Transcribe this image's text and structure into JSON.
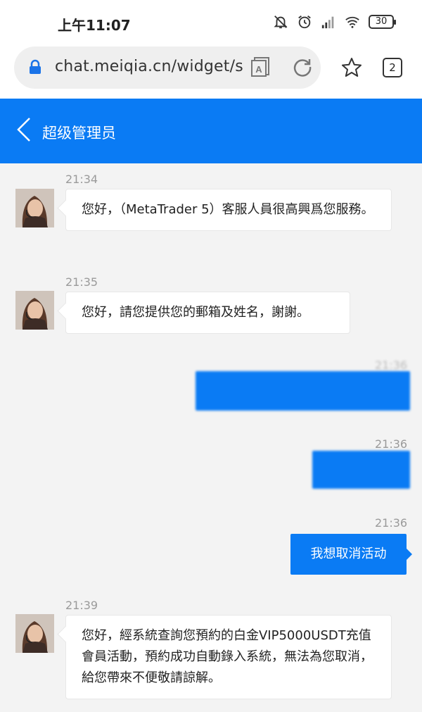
{
  "status_bar": {
    "time": "上午11:07",
    "battery": "30",
    "icons": [
      "mute-icon",
      "alarm-icon",
      "signal-icon",
      "wifi-icon",
      "battery-icon"
    ]
  },
  "browser": {
    "url": "chat.meiqia.cn/widget/sta",
    "tab_count": "2",
    "icons": [
      "lock-icon",
      "reader-mode-icon",
      "reload-icon",
      "star-icon",
      "tabs-icon"
    ]
  },
  "chat": {
    "title": "超级管理员",
    "accent_color": "#0a7bf4",
    "messages": [
      {
        "time": "21:34",
        "direction": "in",
        "text": "您好，（MetaTrader 5）客服人員很高興爲您服務。"
      },
      {
        "time": "21:35",
        "direction": "in",
        "text": "您好，請您提供您的郵箱及姓名，謝謝。"
      },
      {
        "time": "21:36",
        "direction": "out",
        "text": ""
      },
      {
        "time": "21:36",
        "direction": "out",
        "text": ""
      },
      {
        "time": "21:36",
        "direction": "out",
        "text": "我想取消活动"
      },
      {
        "time": "21:39",
        "direction": "in",
        "text": "您好，經系統查詢您預約的白金VIP5000USDT充值會員活動，預約成功自動錄入系統，無法為您取消，給您帶來不便敬請諒解。"
      }
    ]
  }
}
